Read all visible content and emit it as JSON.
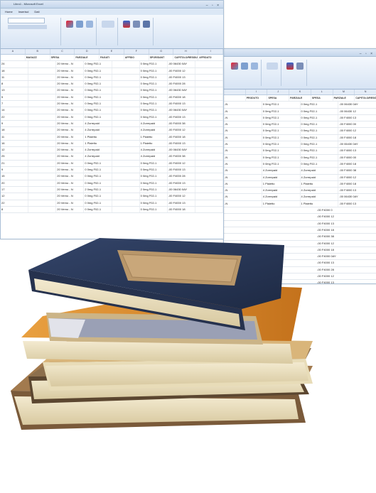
{
  "spreadsheet_back": {
    "headers": [
      "",
      "PRODUTO",
      "SPESA",
      "PARZIALE",
      "SPESA",
      "PARZIALE",
      "CAPITOLO/RESIDUI"
    ],
    "rows": [
      [
        "-N",
        "0 0mg F02-1",
        "0 0mg F02-1",
        "-00 06430 0AY"
      ],
      [
        "-N",
        "0 0mg F02-1",
        "0 0mg F02-1",
        "-00 06430 12"
      ],
      [
        "-N",
        "0 0mg F02-1",
        "0 0mg F02-1",
        "-00 F4000 13"
      ],
      [
        "-N",
        "0 0mg F02-1",
        "0 0mg F02-1",
        "-00 F4000 00"
      ],
      [
        "-N",
        "0 0mg F02-1",
        "0 0mg F02-1",
        "-00 F4000 12"
      ],
      [
        "-N",
        "0 0mg F02-1",
        "0 0mg F02-1",
        "-00 F4000 18"
      ],
      [
        "-N",
        "0 0mg F02-1",
        "0 0mg F02-1",
        "-00 06430 0AY"
      ],
      [
        "-N",
        "0 0mg F02-1",
        "0 0mg F02-1",
        "-00 F4000 13"
      ],
      [
        "-N",
        "0 0mg F02-1",
        "0 0mg F02-1",
        "-00 F4000 00"
      ],
      [
        "-N",
        "0 0mg F02-1",
        "0 0mg F02-1",
        "-00 F4000 18"
      ],
      [
        "-N",
        "4 Zorrepaid",
        "4 Zorrepaid",
        "-00 F4000 38"
      ],
      [
        "-N",
        "4 Zorrepaid",
        "4 Zorrepaid",
        "-00 F4000 12"
      ],
      [
        "-N",
        "1 Plaietto",
        "1 Plaietto",
        "-00 F4000 18"
      ],
      [
        "-N",
        "4 Zorrepaid",
        "4 Zorrepaid",
        "-00 F4000 13"
      ],
      [
        "-N",
        "4 Zorrepaid",
        "4 Zorrepaid",
        "-00 06430 0AY"
      ],
      [
        "-N",
        "1 Plaietto",
        "1 Plaietto",
        "-00 F4000 13"
      ]
    ],
    "right_tail": [
      "0",
      "12",
      "13",
      "18",
      "38",
      "12",
      "18",
      "0AY",
      "13",
      "28",
      "12",
      "13"
    ]
  },
  "spreadsheet_front": {
    "title": "Libro1 - Microsoft Excel",
    "tabs": [
      "Home",
      "Inserisci",
      "Dati"
    ],
    "headers": [
      "",
      "MAGAZZ",
      "SPESA",
      "PARZIALE",
      "PAGATI",
      "AFFIDO",
      "SPOR/DANT",
      "CAPITOLO/RESIDUI",
      "AFFIDATO"
    ],
    "rows": [
      [
        "24",
        "",
        "20 Verno - N",
        "0 0mg F02-1",
        "",
        "0 0mg F02-1",
        "-00 06430 0AY"
      ],
      [
        "18",
        "",
        "20 Verno - N",
        "0 0mg F02-1",
        "",
        "0 0mg F02-1",
        "-00 F4000 12"
      ],
      [
        "11",
        "",
        "20 Verno - N",
        "0 0mg F02-1",
        "",
        "0 0mg F02-1",
        "-00 F4000 13"
      ],
      [
        "8",
        "",
        "20 Verno - N",
        "0 0mg F02-1",
        "",
        "0 0mg F02-1",
        "-00 F4000 28"
      ],
      [
        "13",
        "",
        "20 Verno - N",
        "0 0mg F02-1",
        "",
        "0 0mg F02-1",
        "-00 06430 0AY"
      ],
      [
        "5",
        "",
        "20 Verno - N",
        "0 0mg F02-1",
        "",
        "0 0mg F02-1",
        "-00 F4000 18"
      ],
      [
        "7",
        "",
        "20 Verno - N",
        "0 0mg F02-1",
        "",
        "0 0mg F02-1",
        "-00 F4000 13"
      ],
      [
        "14",
        "",
        "20 Verno - N",
        "0 0mg F02-1",
        "",
        "0 0mg F02-1",
        "-00 06430 0AY"
      ],
      [
        "22",
        "",
        "20 Verno - N",
        "0 0mg F02-1",
        "",
        "0 0mg F02-1",
        "-00 F4000 13"
      ],
      [
        "9",
        "",
        "20 Verno - N",
        "4 Zorrepaid",
        "",
        "4 Zorrepaid",
        "-00 F4000 38"
      ],
      [
        "18",
        "",
        "20 Verno - N",
        "4 Zorrepaid",
        "",
        "4 Zorrepaid",
        "-00 F4000 12"
      ],
      [
        "11",
        "",
        "20 Verno - N",
        "1 Plaietto",
        "",
        "1 Plaietto",
        "-00 F4000 18"
      ],
      [
        "16",
        "",
        "20 Verno - N",
        "1 Plaietto",
        "",
        "1 Plaietto",
        "-00 F4000 13"
      ],
      [
        "12",
        "",
        "20 Verno - N",
        "4 Zorrepaid",
        "",
        "4 Zorrepaid",
        "-00 06430 0AY"
      ],
      [
        "25",
        "",
        "20 Verno - N",
        "4 Zorrepaid",
        "",
        "4 Zorrepaid",
        "-00 F4000 38"
      ],
      [
        "21",
        "",
        "20 Verno - N",
        "0 0mg F02-1",
        "",
        "0 0mg F02-1",
        "-00 F4000 12"
      ],
      [
        "9",
        "",
        "20 Verno - N",
        "0 0mg F02-1",
        "",
        "0 0mg F02-1",
        "-00 F4000 13"
      ],
      [
        "15",
        "",
        "20 Verno - N",
        "0 0mg F02-1",
        "",
        "0 0mg F02-1",
        "-00 F4000 28"
      ],
      [
        "20",
        "",
        "20 Verno - N",
        "0 0mg F02-1",
        "",
        "0 0mg F02-1",
        "-00 F4000 13"
      ],
      [
        "17",
        "",
        "20 Verno - N",
        "2 0mg F02-1",
        "",
        "2 0mg F02-1",
        "-00 06430 0AY"
      ],
      [
        "12",
        "",
        "20 Verno - N",
        "0 0mg F02-1",
        "",
        "0 0mg F02-1",
        "-00 F4000 12"
      ],
      [
        "22",
        "",
        "20 Verno - N",
        "0 0mg F02-1",
        "",
        "0 0mg F02-1",
        "-00 F4000 13"
      ],
      [
        "8",
        "",
        "20 Verno - N",
        "0 0mg F02-1",
        "",
        "0 0mg F02-1",
        "-00 F4000 18"
      ]
    ]
  },
  "colors": {
    "ribbon_blue": "#d7e4f4",
    "book_navy": "#2b3a5a",
    "book_orange": "#d98a2a",
    "book_cream": "#ecdfb8"
  }
}
